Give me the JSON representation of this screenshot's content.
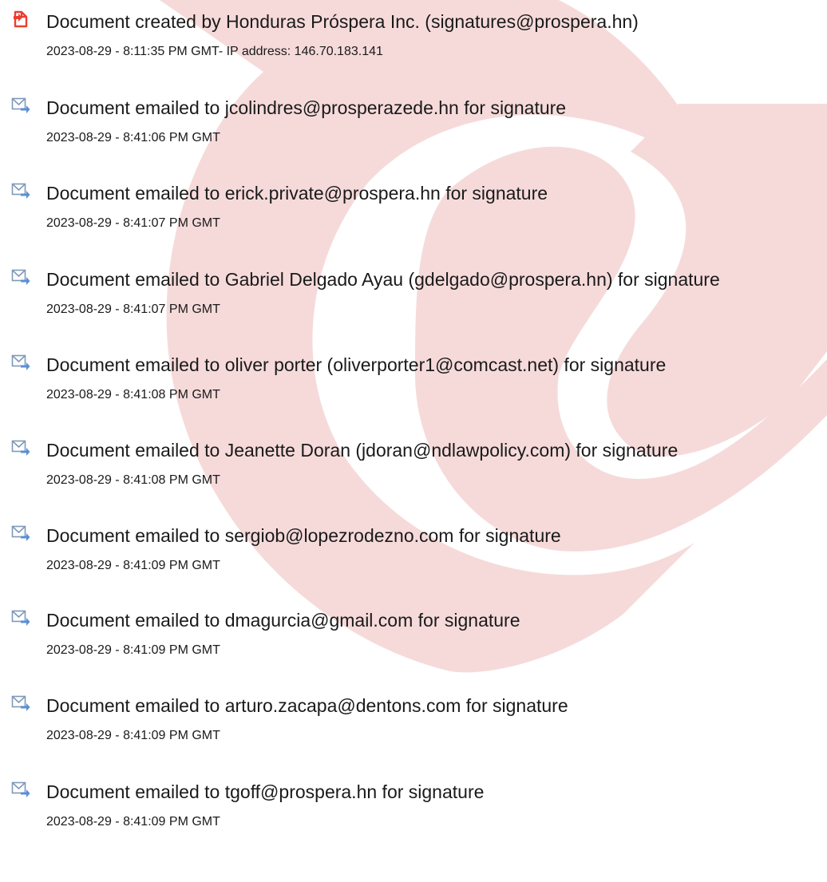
{
  "colors": {
    "watermark": "#f6dada",
    "created_icon": "#ea3f30",
    "email_icon_blue": "#5b8fd4",
    "text": "#1a1a1a"
  },
  "events": [
    {
      "icon": "document-created-icon",
      "text": "Document created by Honduras Próspera Inc. (signatures@prospera.hn)",
      "time": "2023-08-29 - 8:11:35 PM GMT- IP address: 146.70.183.141"
    },
    {
      "icon": "email-sent-icon",
      "text": "Document emailed to jcolindres@prosperazede.hn for signature",
      "time": "2023-08-29 - 8:41:06 PM GMT"
    },
    {
      "icon": "email-sent-icon",
      "text": "Document emailed to erick.private@prospera.hn for signature",
      "time": "2023-08-29 - 8:41:07 PM GMT"
    },
    {
      "icon": "email-sent-icon",
      "text": "Document emailed to Gabriel Delgado Ayau (gdelgado@prospera.hn) for signature",
      "time": "2023-08-29 - 8:41:07 PM GMT"
    },
    {
      "icon": "email-sent-icon",
      "text": "Document emailed to oliver porter (oliverporter1@comcast.net) for signature",
      "time": "2023-08-29 - 8:41:08 PM GMT"
    },
    {
      "icon": "email-sent-icon",
      "text": "Document emailed to Jeanette Doran (jdoran@ndlawpolicy.com) for signature",
      "time": "2023-08-29 - 8:41:08 PM GMT"
    },
    {
      "icon": "email-sent-icon",
      "text": "Document emailed to sergiob@lopezrodezno.com for signature",
      "time": "2023-08-29 - 8:41:09 PM GMT"
    },
    {
      "icon": "email-sent-icon",
      "text": "Document emailed to dmagurcia@gmail.com for signature",
      "time": "2023-08-29 - 8:41:09 PM GMT"
    },
    {
      "icon": "email-sent-icon",
      "text": "Document emailed to arturo.zacapa@dentons.com for signature",
      "time": "2023-08-29 - 8:41:09 PM GMT"
    },
    {
      "icon": "email-sent-icon",
      "text": "Document emailed to tgoff@prospera.hn for signature",
      "time": "2023-08-29 - 8:41:09 PM GMT"
    }
  ]
}
